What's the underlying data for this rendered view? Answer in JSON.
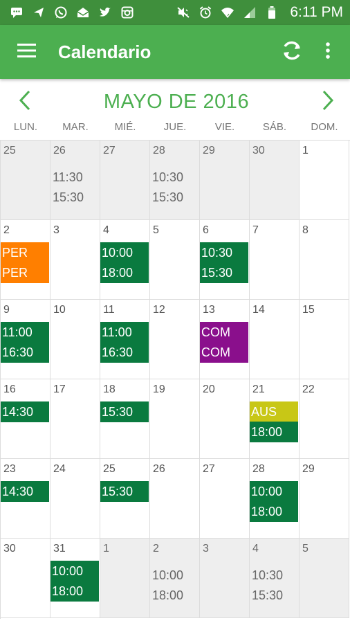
{
  "status_bar": {
    "time": "6:11 PM",
    "left_icons": [
      "chat-icon",
      "send-icon",
      "whatsapp-icon",
      "mail-icon",
      "twitter-icon",
      "instagram-icon"
    ],
    "right_icons": [
      "mute-icon",
      "alarm-icon",
      "wifi-icon",
      "signal-icon",
      "battery-icon"
    ]
  },
  "app_bar": {
    "title": "Calendario",
    "menu_icon": "hamburger-menu-icon",
    "actions": [
      "refresh-icon",
      "more-vert-icon"
    ]
  },
  "month": {
    "title": "MAYO DE 2016",
    "prev_icon": "chevron-left-icon",
    "next_icon": "chevron-right-icon"
  },
  "weekdays": [
    "LUN.",
    "MAR.",
    "MIÉ.",
    "JUE.",
    "VIE.",
    "SÁB.",
    "DOM."
  ],
  "colors": {
    "app_bar": "#4caf50",
    "status_bar": "#3f8f3c",
    "event_green": "#0a7a3f",
    "event_orange": "#ff7f00",
    "event_purple": "#8a0f8c",
    "event_lime": "#c8c716",
    "other_month_bg": "#eeeeee"
  },
  "weeks": [
    [
      {
        "day": "25",
        "other": true,
        "times": [],
        "events": []
      },
      {
        "day": "26",
        "other": true,
        "times": [
          "11:30",
          "15:30"
        ],
        "events": []
      },
      {
        "day": "27",
        "other": true,
        "times": [],
        "events": []
      },
      {
        "day": "28",
        "other": true,
        "times": [
          "10:30",
          "15:30"
        ],
        "events": []
      },
      {
        "day": "29",
        "other": true,
        "times": [],
        "events": []
      },
      {
        "day": "30",
        "other": true,
        "times": [],
        "events": []
      },
      {
        "day": "1",
        "other": false,
        "times": [],
        "events": []
      }
    ],
    [
      {
        "day": "2",
        "other": false,
        "times": [],
        "events": [
          {
            "text": "PER",
            "color": "orange"
          },
          {
            "text": "PER",
            "color": "orange"
          }
        ]
      },
      {
        "day": "3",
        "other": false,
        "times": [],
        "events": []
      },
      {
        "day": "4",
        "other": false,
        "times": [],
        "events": [
          {
            "text": "10:00",
            "color": "green"
          },
          {
            "text": "18:00",
            "color": "green"
          }
        ]
      },
      {
        "day": "5",
        "other": false,
        "times": [],
        "events": []
      },
      {
        "day": "6",
        "other": false,
        "times": [],
        "events": [
          {
            "text": "10:30",
            "color": "green"
          },
          {
            "text": "15:30",
            "color": "green"
          }
        ]
      },
      {
        "day": "7",
        "other": false,
        "times": [],
        "events": []
      },
      {
        "day": "8",
        "other": false,
        "times": [],
        "events": []
      }
    ],
    [
      {
        "day": "9",
        "other": false,
        "times": [],
        "events": [
          {
            "text": "11:00",
            "color": "green"
          },
          {
            "text": "16:30",
            "color": "green"
          }
        ]
      },
      {
        "day": "10",
        "other": false,
        "times": [],
        "events": []
      },
      {
        "day": "11",
        "other": false,
        "times": [],
        "events": [
          {
            "text": "11:00",
            "color": "green"
          },
          {
            "text": "16:30",
            "color": "green"
          }
        ]
      },
      {
        "day": "12",
        "other": false,
        "times": [],
        "events": []
      },
      {
        "day": "13",
        "other": false,
        "times": [],
        "events": [
          {
            "text": "COM",
            "color": "purple"
          },
          {
            "text": "COM",
            "color": "purple"
          }
        ]
      },
      {
        "day": "14",
        "other": false,
        "times": [],
        "events": []
      },
      {
        "day": "15",
        "other": false,
        "times": [],
        "events": []
      }
    ],
    [
      {
        "day": "16",
        "other": false,
        "times": [],
        "events": [
          {
            "text": "14:30",
            "color": "green"
          }
        ]
      },
      {
        "day": "17",
        "other": false,
        "times": [],
        "events": []
      },
      {
        "day": "18",
        "other": false,
        "times": [],
        "events": [
          {
            "text": "15:30",
            "color": "green"
          }
        ]
      },
      {
        "day": "19",
        "other": false,
        "times": [],
        "events": []
      },
      {
        "day": "20",
        "other": false,
        "times": [],
        "events": []
      },
      {
        "day": "21",
        "other": false,
        "times": [],
        "events": [
          {
            "text": "AUS",
            "color": "lime"
          },
          {
            "text": "18:00",
            "color": "green"
          }
        ]
      },
      {
        "day": "22",
        "other": false,
        "times": [],
        "events": []
      }
    ],
    [
      {
        "day": "23",
        "other": false,
        "times": [],
        "events": [
          {
            "text": "14:30",
            "color": "green"
          }
        ]
      },
      {
        "day": "24",
        "other": false,
        "times": [],
        "events": []
      },
      {
        "day": "25",
        "other": false,
        "times": [],
        "events": [
          {
            "text": "15:30",
            "color": "green"
          }
        ]
      },
      {
        "day": "26",
        "other": false,
        "times": [],
        "events": []
      },
      {
        "day": "27",
        "other": false,
        "times": [],
        "events": []
      },
      {
        "day": "28",
        "other": false,
        "times": [],
        "events": [
          {
            "text": "10:00",
            "color": "green"
          },
          {
            "text": "18:00",
            "color": "green"
          }
        ]
      },
      {
        "day": "29",
        "other": false,
        "times": [],
        "events": []
      }
    ],
    [
      {
        "day": "30",
        "other": false,
        "times": [],
        "events": []
      },
      {
        "day": "31",
        "other": false,
        "times": [],
        "events": [
          {
            "text": "10:00",
            "color": "green"
          },
          {
            "text": "18:00",
            "color": "green"
          }
        ]
      },
      {
        "day": "1",
        "other": true,
        "times": [],
        "events": []
      },
      {
        "day": "2",
        "other": true,
        "times": [
          "10:00",
          "18:00"
        ],
        "events": []
      },
      {
        "day": "3",
        "other": true,
        "times": [],
        "events": []
      },
      {
        "day": "4",
        "other": true,
        "times": [
          "10:30",
          "15:30"
        ],
        "events": []
      },
      {
        "day": "5",
        "other": true,
        "times": [],
        "events": []
      }
    ]
  ]
}
